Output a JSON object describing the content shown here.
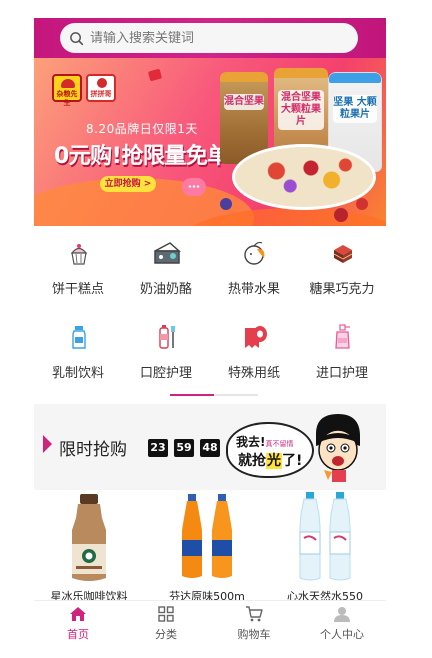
{
  "search": {
    "placeholder": "请输入搜索关键词"
  },
  "banner": {
    "logo_left": "杂粮先生",
    "logo_right": "拼拼哥",
    "subtitle": "8.20品牌日仅限1天",
    "headline": "0元购!抢限量免单",
    "cta": "立即抢购 >",
    "jar_label_1": "混合坚果",
    "jar_label_2": "混合坚果 大颗粒果片",
    "jar_label_3": "坚果 大颗粒果片"
  },
  "categories": [
    {
      "label": "饼干糕点",
      "icon": "cupcake-icon"
    },
    {
      "label": "奶油奶酪",
      "icon": "cheese-icon"
    },
    {
      "label": "热带水果",
      "icon": "fruit-icon"
    },
    {
      "label": "糖果巧克力",
      "icon": "chocolate-cake-icon"
    },
    {
      "label": "乳制饮料",
      "icon": "milk-bottle-icon"
    },
    {
      "label": "口腔护理",
      "icon": "toothpaste-icon"
    },
    {
      "label": "特殊用纸",
      "icon": "tissue-roll-icon"
    },
    {
      "label": "进口护理",
      "icon": "lotion-bottle-icon"
    }
  ],
  "flash_sale": {
    "title": "限时抢购",
    "countdown": {
      "hours": "23",
      "minutes": "59",
      "seconds": "48"
    },
    "bubble_line1": "我去!",
    "bubble_small": "真不留情",
    "bubble_line2_a": "就抢",
    "bubble_line2_b": "光",
    "bubble_line2_c": "了!"
  },
  "products": [
    {
      "name": "星冰乐咖啡饮料"
    },
    {
      "name": "芬达原味500m"
    },
    {
      "name": "心水天然水550"
    }
  ],
  "tabbar": [
    {
      "label": "首页",
      "icon": "home-icon",
      "active": true
    },
    {
      "label": "分类",
      "icon": "grid-icon",
      "active": false
    },
    {
      "label": "购物车",
      "icon": "cart-icon",
      "active": false
    },
    {
      "label": "个人中心",
      "icon": "user-icon",
      "active": false
    }
  ],
  "colors": {
    "brand": "#c4167c",
    "accent": "#d0237d",
    "countdown_bg": "#111111"
  }
}
